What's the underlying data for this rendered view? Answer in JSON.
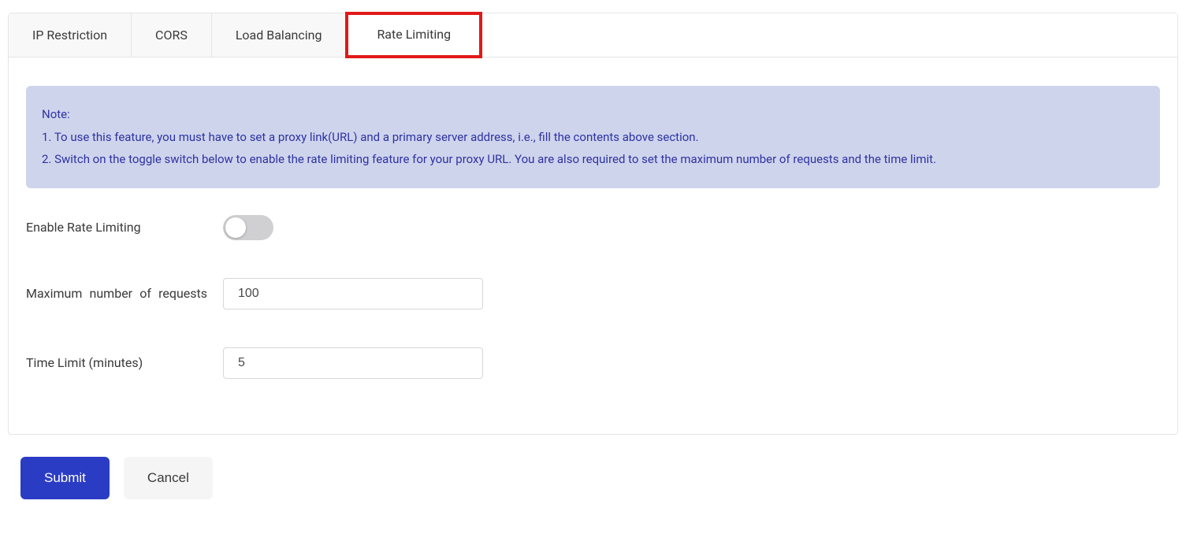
{
  "tabs": [
    {
      "label": "IP Restriction"
    },
    {
      "label": "CORS"
    },
    {
      "label": "Load Balancing"
    },
    {
      "label": "Rate Limiting"
    }
  ],
  "note": {
    "title": "Note:",
    "line1": "1. To use this feature, you must have to set a proxy link(URL) and a primary server address, i.e., fill the contents above section.",
    "line2": "2. Switch on the toggle switch below to enable the rate limiting feature for your proxy URL. You are also required to set the maximum number of requests and the time limit."
  },
  "form": {
    "enable_label": "Enable Rate Limiting",
    "enable_value": false,
    "max_label": "Maximum number of requests",
    "max_value": "100",
    "time_label": "Time Limit (minutes)",
    "time_value": "5"
  },
  "actions": {
    "submit": "Submit",
    "cancel": "Cancel"
  }
}
